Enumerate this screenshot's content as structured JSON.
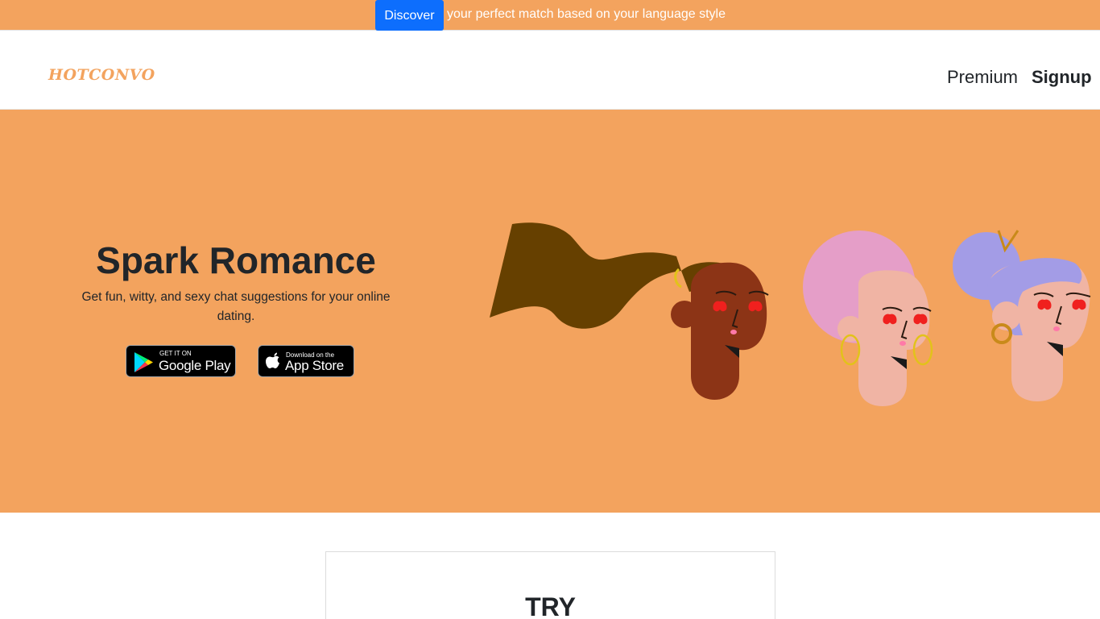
{
  "banner": {
    "button_label": "Discover",
    "text": "your perfect match based on your language style"
  },
  "nav": {
    "brand": "HOTCONVO",
    "premium": "Premium",
    "signup": "Signup"
  },
  "hero": {
    "title": "Spark Romance",
    "subtitle": "Get fun, witty, and sexy chat suggestions for your online dating.",
    "google_play": {
      "small": "GET IT ON",
      "big": "Google Play"
    },
    "app_store": {
      "small": "Download on the",
      "big": "App Store"
    }
  },
  "try_section": {
    "title": "TRY"
  },
  "colors": {
    "accent": "#f3a35e",
    "primary_button": "#0d6efd",
    "text": "#212529"
  }
}
